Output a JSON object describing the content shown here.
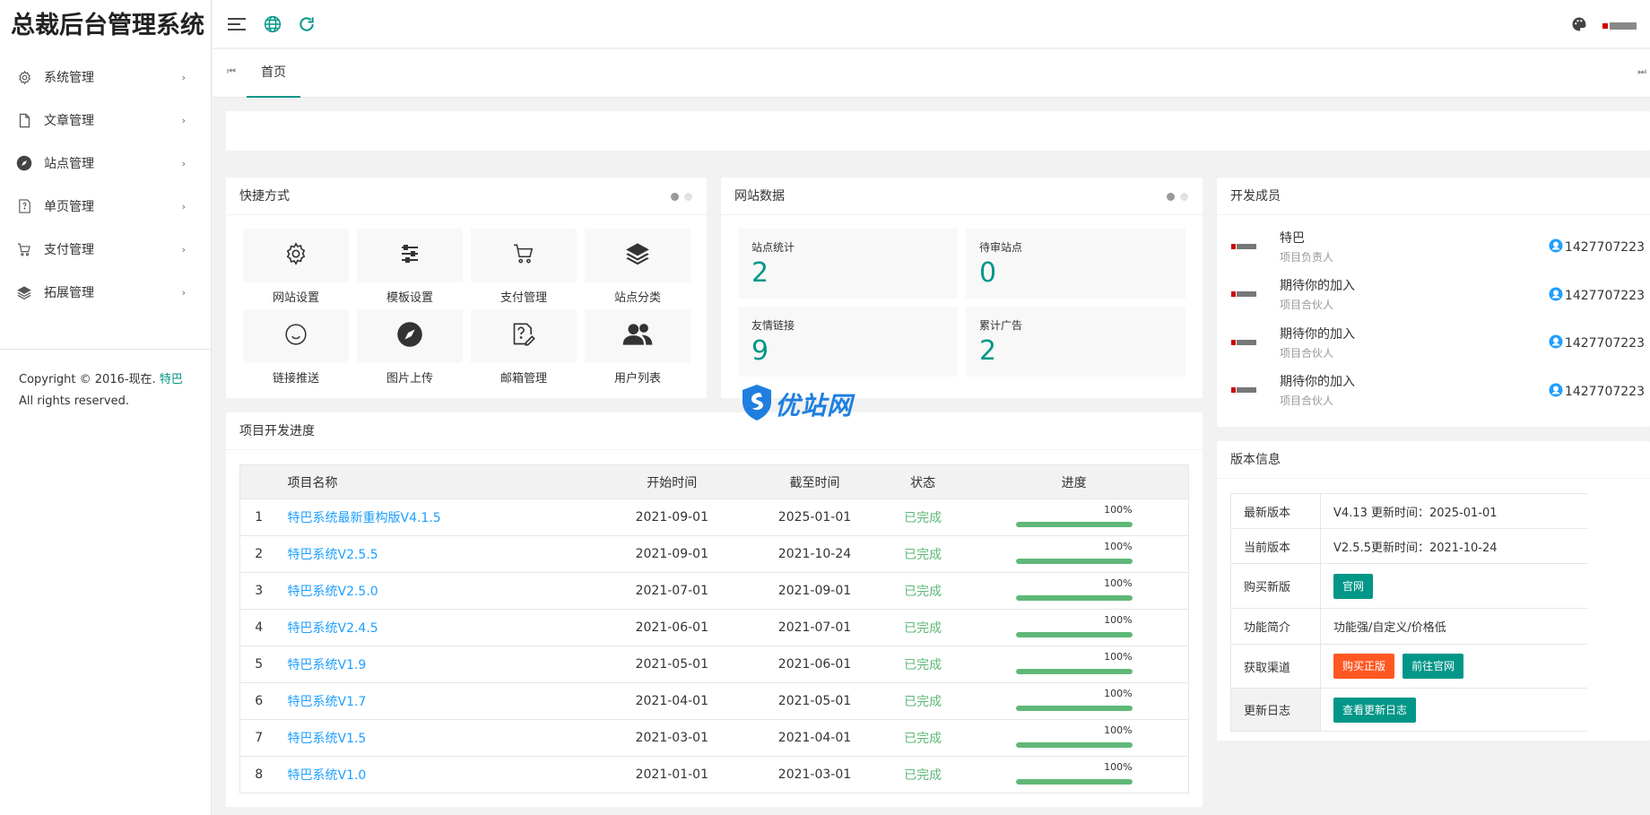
{
  "app": {
    "title": "总裁后台管理系统"
  },
  "sidebar": {
    "items": [
      {
        "label": "系统管理",
        "icon": "gear-icon",
        "arrow": "›"
      },
      {
        "label": "文章管理",
        "icon": "file-icon",
        "arrow": "›"
      },
      {
        "label": "站点管理",
        "icon": "compass-icon",
        "arrow": "›"
      },
      {
        "label": "单页管理",
        "icon": "page-help-icon",
        "arrow": "›"
      },
      {
        "label": "支付管理",
        "icon": "cart-icon",
        "arrow": "›"
      },
      {
        "label": "拓展管理",
        "icon": "layers-icon",
        "arrow": "›"
      }
    ],
    "copyright_prefix": "Copyright © 2016-现在.",
    "copyright_link": "特巴",
    "copyright_suffix": "All rights reserved."
  },
  "header": {
    "menu_icon": "hamburger-icon",
    "globe_icon": "globe-icon",
    "refresh_icon": "refresh-icon",
    "theme_icon": "palette-icon",
    "user_logo": "brand-logo"
  },
  "tabs": {
    "home": "首页",
    "prev_icon": "⏮",
    "next_icon": "⏭"
  },
  "shortcuts": {
    "title": "快捷方式",
    "items": [
      {
        "label": "网站设置",
        "icon": "gear-icon"
      },
      {
        "label": "模板设置",
        "icon": "sliders-icon"
      },
      {
        "label": "支付管理",
        "icon": "cart-icon"
      },
      {
        "label": "站点分类",
        "icon": "layers-icon"
      },
      {
        "label": "链接推送",
        "icon": "smile-icon"
      },
      {
        "label": "图片上传",
        "icon": "compass-icon"
      },
      {
        "label": "邮箱管理",
        "icon": "page-edit-icon"
      },
      {
        "label": "用户列表",
        "icon": "users-icon"
      }
    ]
  },
  "site_data": {
    "title": "网站数据",
    "stats": [
      {
        "label": "站点统计",
        "value": "2"
      },
      {
        "label": "待审站点",
        "value": "0"
      },
      {
        "label": "友情链接",
        "value": "9"
      },
      {
        "label": "累计广告",
        "value": "2"
      }
    ]
  },
  "members": {
    "title": "开发成员",
    "items": [
      {
        "name": "特巴",
        "role": "项目负责人",
        "qq": "1427707223"
      },
      {
        "name": "期待你的加入",
        "role": "项目合伙人",
        "qq": "1427707223"
      },
      {
        "name": "期待你的加入",
        "role": "项目合伙人",
        "qq": "1427707223"
      },
      {
        "name": "期待你的加入",
        "role": "项目合伙人",
        "qq": "1427707223"
      }
    ]
  },
  "progress": {
    "title": "项目开发进度",
    "headers": [
      "",
      "项目名称",
      "开始时间",
      "截至时间",
      "状态",
      "进度"
    ],
    "rows": [
      {
        "idx": "1",
        "name": "特巴系统最新重构版V4.1.5",
        "start": "2021-09-01",
        "end": "2025-01-01",
        "status": "已完成",
        "percent_text": "100%",
        "percent": 100
      },
      {
        "idx": "2",
        "name": "特巴系统V2.5.5",
        "start": "2021-09-01",
        "end": "2021-10-24",
        "status": "已完成",
        "percent_text": "100%",
        "percent": 100
      },
      {
        "idx": "3",
        "name": "特巴系统V2.5.0",
        "start": "2021-07-01",
        "end": "2021-09-01",
        "status": "已完成",
        "percent_text": "100%",
        "percent": 100
      },
      {
        "idx": "4",
        "name": "特巴系统V2.4.5",
        "start": "2021-06-01",
        "end": "2021-07-01",
        "status": "已完成",
        "percent_text": "100%",
        "percent": 100
      },
      {
        "idx": "5",
        "name": "特巴系统V1.9",
        "start": "2021-05-01",
        "end": "2021-06-01",
        "status": "已完成",
        "percent_text": "100%",
        "percent": 100
      },
      {
        "idx": "6",
        "name": "特巴系统V1.7",
        "start": "2021-04-01",
        "end": "2021-05-01",
        "status": "已完成",
        "percent_text": "100%",
        "percent": 100
      },
      {
        "idx": "7",
        "name": "特巴系统V1.5",
        "start": "2021-03-01",
        "end": "2021-04-01",
        "status": "已完成",
        "percent_text": "100%",
        "percent": 100
      },
      {
        "idx": "8",
        "name": "特巴系统V1.0",
        "start": "2021-01-01",
        "end": "2021-03-01",
        "status": "已完成",
        "percent_text": "100%",
        "percent": 100
      }
    ]
  },
  "version": {
    "title": "版本信息",
    "latest_label": "最新版本",
    "latest_value": "V4.13 更新时间：2025-01-01",
    "current_label": "当前版本",
    "current_value": "V2.5.5更新时间：2021-10-24",
    "buy_label": "购买新版",
    "buy_btn": "官网",
    "intro_label": "功能简介",
    "intro_value": "功能强/自定义/价格低",
    "channel_label": "获取渠道",
    "channel_btn1": "购买正版",
    "channel_btn2": "前往官网",
    "log_label": "更新日志",
    "log_btn": "查看更新日志"
  },
  "watermark": {
    "text": "优站网"
  },
  "colors": {
    "accent": "#009688",
    "link": "#1e9fff",
    "success": "#5fb878",
    "danger": "#ff5722"
  }
}
